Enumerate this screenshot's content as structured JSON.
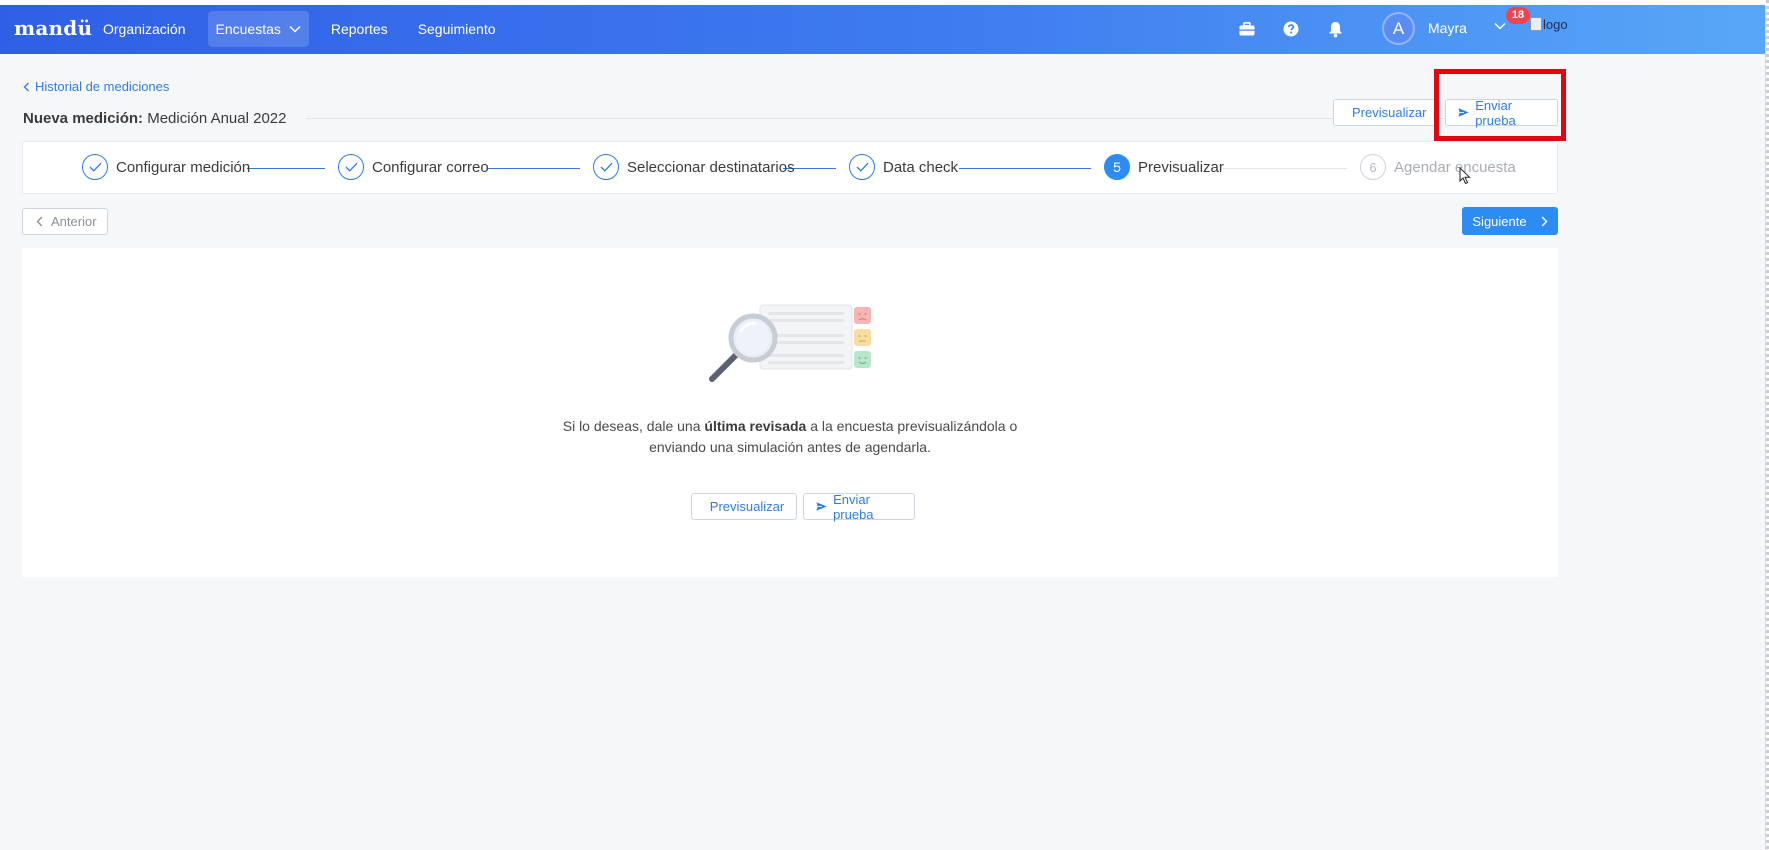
{
  "app": {
    "brand": "mandü",
    "nav": [
      {
        "label": "Organización"
      },
      {
        "label": "Encuestas",
        "active": true,
        "has_dropdown": true
      },
      {
        "label": "Reportes"
      },
      {
        "label": "Seguimiento"
      }
    ],
    "topbar_icons": [
      "briefcase-icon",
      "help-icon",
      "bell-icon"
    ],
    "notification_count": "18",
    "user": {
      "avatar_initial": "A",
      "name": "Mayra"
    },
    "logo_alt": "logo"
  },
  "breadcrumb": "Historial de mediciones",
  "title": {
    "prefix": "Nueva medición:",
    "name": "Medición Anual 2022"
  },
  "actions": {
    "preview": "Previsualizar",
    "send_test": "Enviar prueba"
  },
  "steps": [
    {
      "number": "1",
      "label": "Configurar medición",
      "state": "done"
    },
    {
      "number": "2",
      "label": "Configurar correo",
      "state": "done"
    },
    {
      "number": "3",
      "label": "Seleccionar destinatarios",
      "state": "done"
    },
    {
      "number": "4",
      "label": "Data check",
      "state": "done"
    },
    {
      "number": "5",
      "label": "Previsualizar",
      "state": "current"
    },
    {
      "number": "6",
      "label": "Agendar encuesta",
      "state": "pending"
    }
  ],
  "navigation": {
    "prev": "Anterior",
    "next": "Siguiente"
  },
  "main": {
    "desc_part1": "Si lo deseas, dale una ",
    "desc_bold": "última revisada",
    "desc_part2": " a la encuesta previsualizándola o",
    "desc_line2": "enviando una simulación antes de agendarla.",
    "preview": "Previsualizar",
    "send_test": "Enviar prueba"
  },
  "colors": {
    "primary": "#2c8cf4",
    "link": "#2f7de1",
    "highlight": "#e20613"
  }
}
